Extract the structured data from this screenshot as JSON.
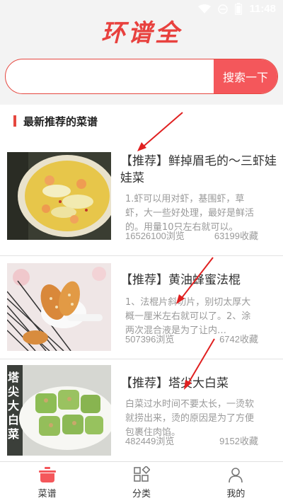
{
  "status_bar": {
    "time": "11:48"
  },
  "header": {
    "logo_text": "环谱全"
  },
  "search": {
    "placeholder": "",
    "button_label": "搜索一下"
  },
  "section": {
    "title": "最新推荐的菜谱"
  },
  "recipes": [
    {
      "title": "【推荐】鲜掉眉毛的～三虾娃娃菜",
      "desc": "1.虾可以用对虾，基围虾，草虾，大一些好处理，最好是鲜活的。用量10只左右就可以。",
      "views": "16526100浏览",
      "favs": "63199收藏",
      "image_icon": "shrimp-cabbage-dish"
    },
    {
      "title": "【推荐】黄油蜂蜜法棍",
      "desc": "1、法棍片斜切片，别切太厚大概一厘米左右就可以了。2、涂两次混合液是为了让内…",
      "views": "507396浏览",
      "favs": "6742收藏",
      "image_icon": "honey-butter-baguette"
    },
    {
      "title": "【推荐】塔尖大白菜",
      "desc": "白菜过水时间不要太长，一烫软就捞出来，烫的原因是为了方便包裹住肉馅。",
      "views": "482449浏览",
      "favs": "9152收藏",
      "image_icon": "cabbage-rolls",
      "image_caption": "塔尖大白菜"
    }
  ],
  "tabbar": {
    "tabs": [
      {
        "label": "菜谱",
        "icon": "pot-icon",
        "active": true
      },
      {
        "label": "分类",
        "icon": "category-icon",
        "active": false
      },
      {
        "label": "我的",
        "icon": "person-icon",
        "active": false
      }
    ]
  },
  "colors": {
    "accent": "#e5473f",
    "button": "#f4575b",
    "background": "#f3f3f3"
  }
}
